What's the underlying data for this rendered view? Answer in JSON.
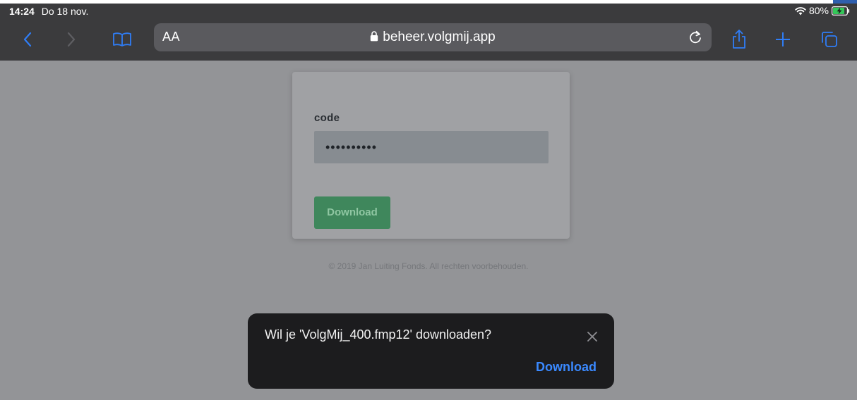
{
  "status_bar": {
    "time": "14:24",
    "date": "Do 18 nov.",
    "battery_percent": "80%",
    "wifi_icon": "wifi-icon",
    "battery_icon": "battery-charging-icon"
  },
  "toolbar": {
    "aa_label": "AA",
    "url": "beheer.volgmij.app",
    "icons": [
      "back-icon",
      "forward-icon",
      "bookmarks-icon",
      "lock-icon",
      "reload-icon",
      "share-icon",
      "new-tab-icon",
      "tabs-icon"
    ]
  },
  "page": {
    "code_label": "code",
    "code_value": "••••••••••",
    "download_button": "Download",
    "footer": "© 2019 Jan Luiting Fonds. All rechten voorbehouden."
  },
  "prompt": {
    "message": "Wil je 'VolgMij_400.fmp12' downloaden?",
    "download_label": "Download"
  },
  "colors": {
    "toolbar_bg": "#3b3b3d",
    "address_bar_bg": "#5a5a5e",
    "page_bg": "#939497",
    "button_green": "#3f875c",
    "prompt_bg": "#1c1c1e",
    "link_blue": "#3a89ff",
    "ios_blue": "#2f7df6"
  }
}
